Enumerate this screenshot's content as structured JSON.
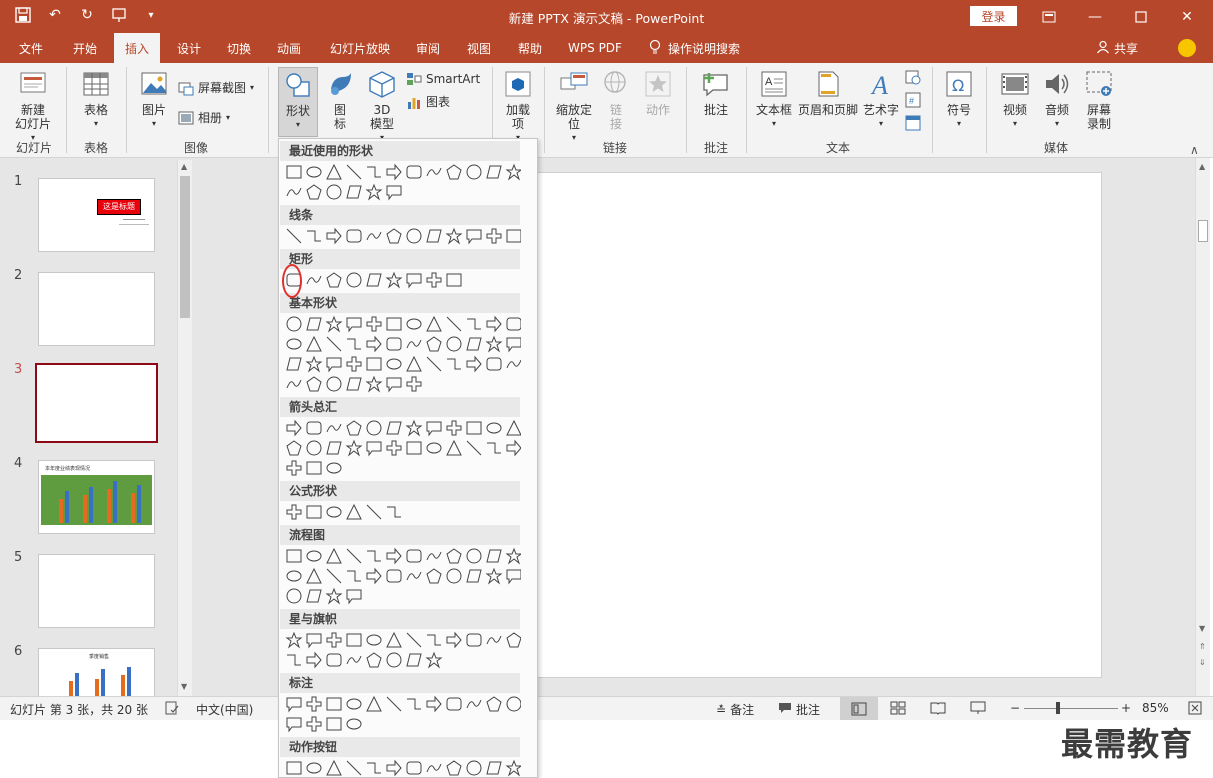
{
  "titlebar": {
    "title": "新建 PPTX 演示文稿  -  PowerPoint",
    "login": "登录",
    "bg_color": "#b7472a"
  },
  "tabs": [
    {
      "label": "文件"
    },
    {
      "label": "开始"
    },
    {
      "label": "插入"
    },
    {
      "label": "设计"
    },
    {
      "label": "切换"
    },
    {
      "label": "动画"
    },
    {
      "label": "幻灯片放映"
    },
    {
      "label": "审阅"
    },
    {
      "label": "视图"
    },
    {
      "label": "帮助"
    },
    {
      "label": "WPS PDF"
    }
  ],
  "active_tab": "插入",
  "tell_me": "操作说明搜索",
  "share": "共享",
  "ribbon": {
    "new_slide": "新建\n幻灯片",
    "table": "表格",
    "picture": "图片",
    "screenshot": "屏幕截图",
    "album": "相册",
    "shapes": "形状",
    "icons": "图\n标",
    "model3d": "3D\n模型",
    "smartart": "SmartArt",
    "chart": "图表",
    "addins": "加载\n项",
    "zoom": "缩放定\n位",
    "link": "链\n接",
    "action": "动作",
    "comment": "批注",
    "textbox": "文本框",
    "header_footer": "页眉和页脚",
    "wordart": "艺术字",
    "symbol": "符号",
    "video": "视频",
    "audio": "音频",
    "screen_record": "屏幕\n录制",
    "groups": {
      "slides": "幻灯片",
      "tables": "表格",
      "images": "图像",
      "links": "链接",
      "comments": "批注",
      "text": "文本",
      "media": "媒体"
    }
  },
  "thumbnails": [
    {
      "num": "1",
      "title": "这是标题"
    },
    {
      "num": "2"
    },
    {
      "num": "3"
    },
    {
      "num": "4",
      "caption": "本年度业绩表现情况"
    },
    {
      "num": "5"
    },
    {
      "num": "6",
      "caption": "季度销售"
    }
  ],
  "current_slide": 3,
  "shapes_panel": {
    "sections": [
      "最近使用的形状",
      "线条",
      "矩形",
      "基本形状",
      "箭头总汇",
      "公式形状",
      "流程图",
      "星与旗帜",
      "标注",
      "动作按钮"
    ]
  },
  "status": {
    "slide_info": "幻灯片 第 3 张，共 20 张",
    "language": "中文(中国)",
    "notes": "备注",
    "comments": "批注",
    "zoom": "85%"
  },
  "watermark": "最需教育"
}
